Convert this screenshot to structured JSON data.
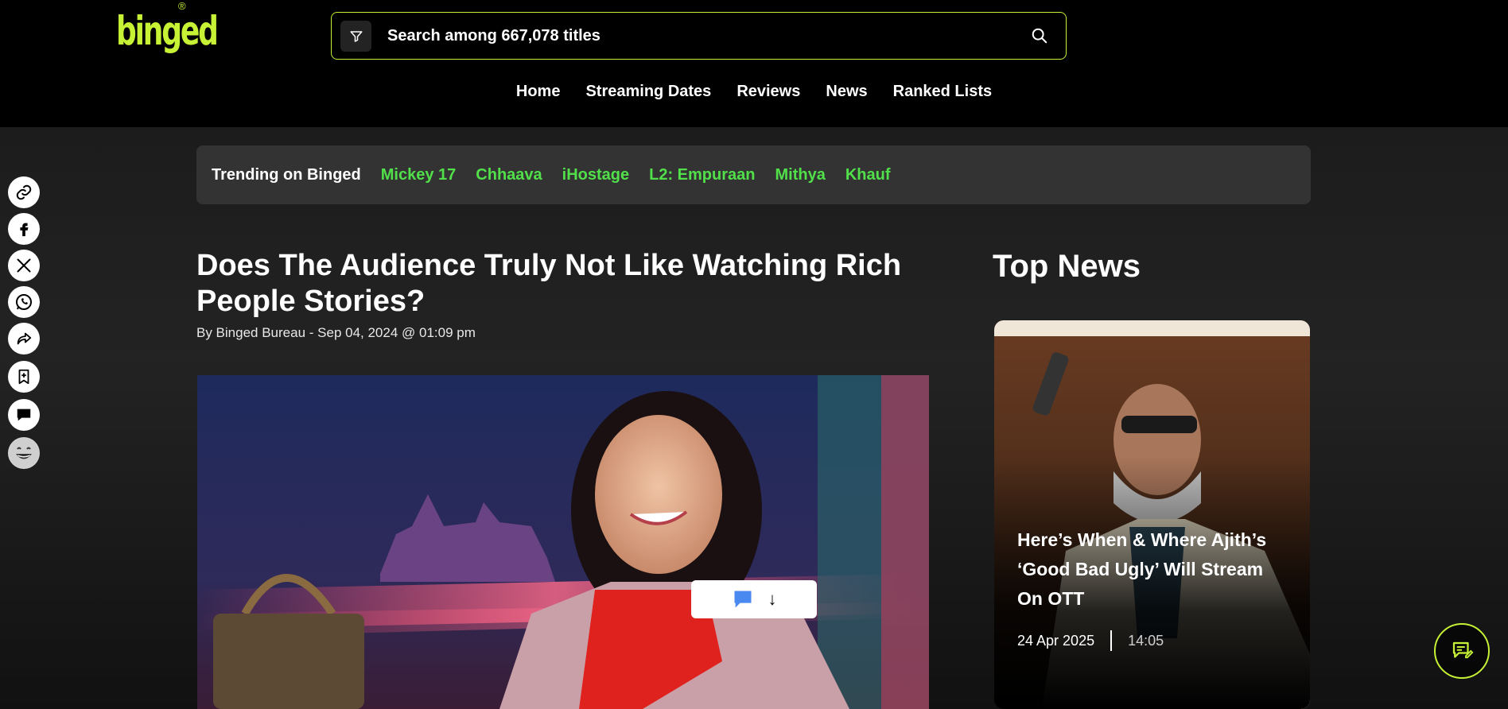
{
  "header": {
    "logo_text": "binged",
    "logo_reg": "®",
    "search_placeholder": "Search among 667,078 titles",
    "accent_color": "#c6f135"
  },
  "nav": {
    "items": [
      "Home",
      "Streaming Dates",
      "Reviews",
      "News",
      "Ranked Lists"
    ]
  },
  "trending": {
    "label": "Trending on Binged",
    "items": [
      "Mickey 17",
      "Chhaava",
      "iHostage",
      "L2: Empuraan",
      "Mithya",
      "Khauf"
    ],
    "link_color": "#51e04a"
  },
  "article": {
    "title": "Does The Audience Truly Not Like Watching Rich People Stories?",
    "byline": "By Binged Bureau - Sep 04, 2024 @ 01:09 pm"
  },
  "chat_toggle": {
    "icon": "comment-icon",
    "arrow": "↓"
  },
  "top_news": {
    "heading": "Top News",
    "card": {
      "title": "Here’s When & Where Ajith’s ‘Good Bad Ugly’ Will Stream On OTT",
      "date": "24 Apr 2025",
      "time": "14:05"
    }
  },
  "share_rail": {
    "icons": [
      "link-icon",
      "facebook-icon",
      "x-icon",
      "whatsapp-icon",
      "share-icon",
      "bookmark-icon",
      "comment-icon",
      "emoji-icon"
    ]
  },
  "floating_button": {
    "icon": "feedback-icon"
  }
}
